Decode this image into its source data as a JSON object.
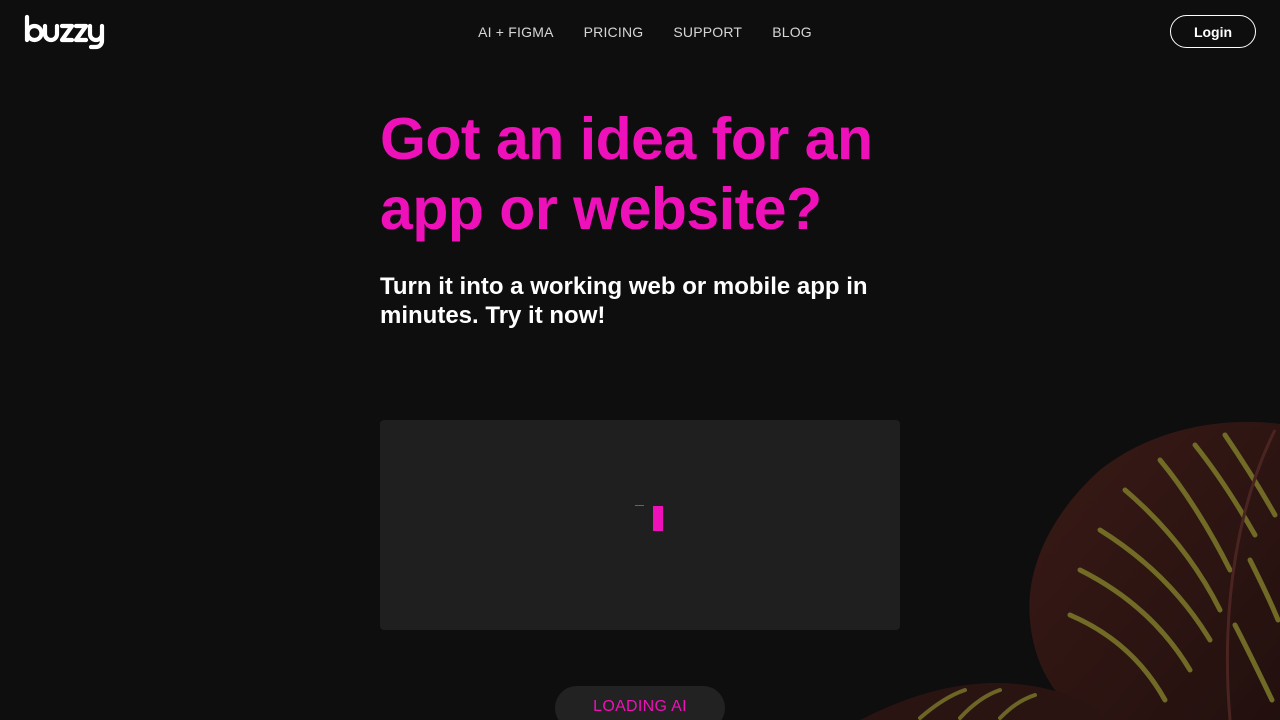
{
  "brand": {
    "name": "buzzy",
    "accent": "#ee10b8",
    "background": "#0e0e0e"
  },
  "nav": {
    "items": [
      {
        "label": "AI + FIGMA"
      },
      {
        "label": "PRICING"
      },
      {
        "label": "SUPPORT"
      },
      {
        "label": "BLOG"
      }
    ],
    "login_label": "Login"
  },
  "hero": {
    "headline": "Got an idea for an app or website?",
    "subheadline": "Turn it into a working web or mobile app in minutes. Try it now!"
  },
  "ai_input": {
    "state": "typing-cursor"
  },
  "loading_button": {
    "label": "LOADING AI"
  },
  "decor": {
    "icon": "leaf-illustration"
  }
}
